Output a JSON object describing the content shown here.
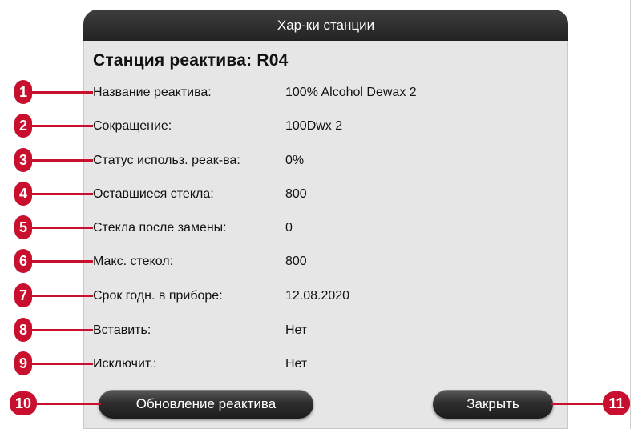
{
  "dialog": {
    "title": "Хар-ки станции",
    "heading": "Станция реактива: R04"
  },
  "fields": [
    {
      "label": "Название реактива:",
      "value": "100% Alcohol Dewax 2"
    },
    {
      "label": "Сокращение:",
      "value": "100Dwx 2"
    },
    {
      "label": "Статус использ. реак-ва:",
      "value": "0%"
    },
    {
      "label": "Оставшиеся стекла:",
      "value": "800"
    },
    {
      "label": "Стекла после замены:",
      "value": "0"
    },
    {
      "label": "Макс. стекол:",
      "value": "800"
    },
    {
      "label": "Срок годн. в приборе:",
      "value": "12.08.2020"
    },
    {
      "label": "Вставить:",
      "value": "Нет"
    },
    {
      "label": "Исключит.:",
      "value": "Нет"
    }
  ],
  "buttons": {
    "update_reagent": "Обновление реактива",
    "close": "Закрыть"
  },
  "callouts": [
    "1",
    "2",
    "3",
    "4",
    "5",
    "6",
    "7",
    "8",
    "9",
    "10",
    "11"
  ],
  "colors": {
    "callout": "#c8102e",
    "titlebar": "#2b2b2b",
    "dialog_bg": "#e6e6e6"
  }
}
